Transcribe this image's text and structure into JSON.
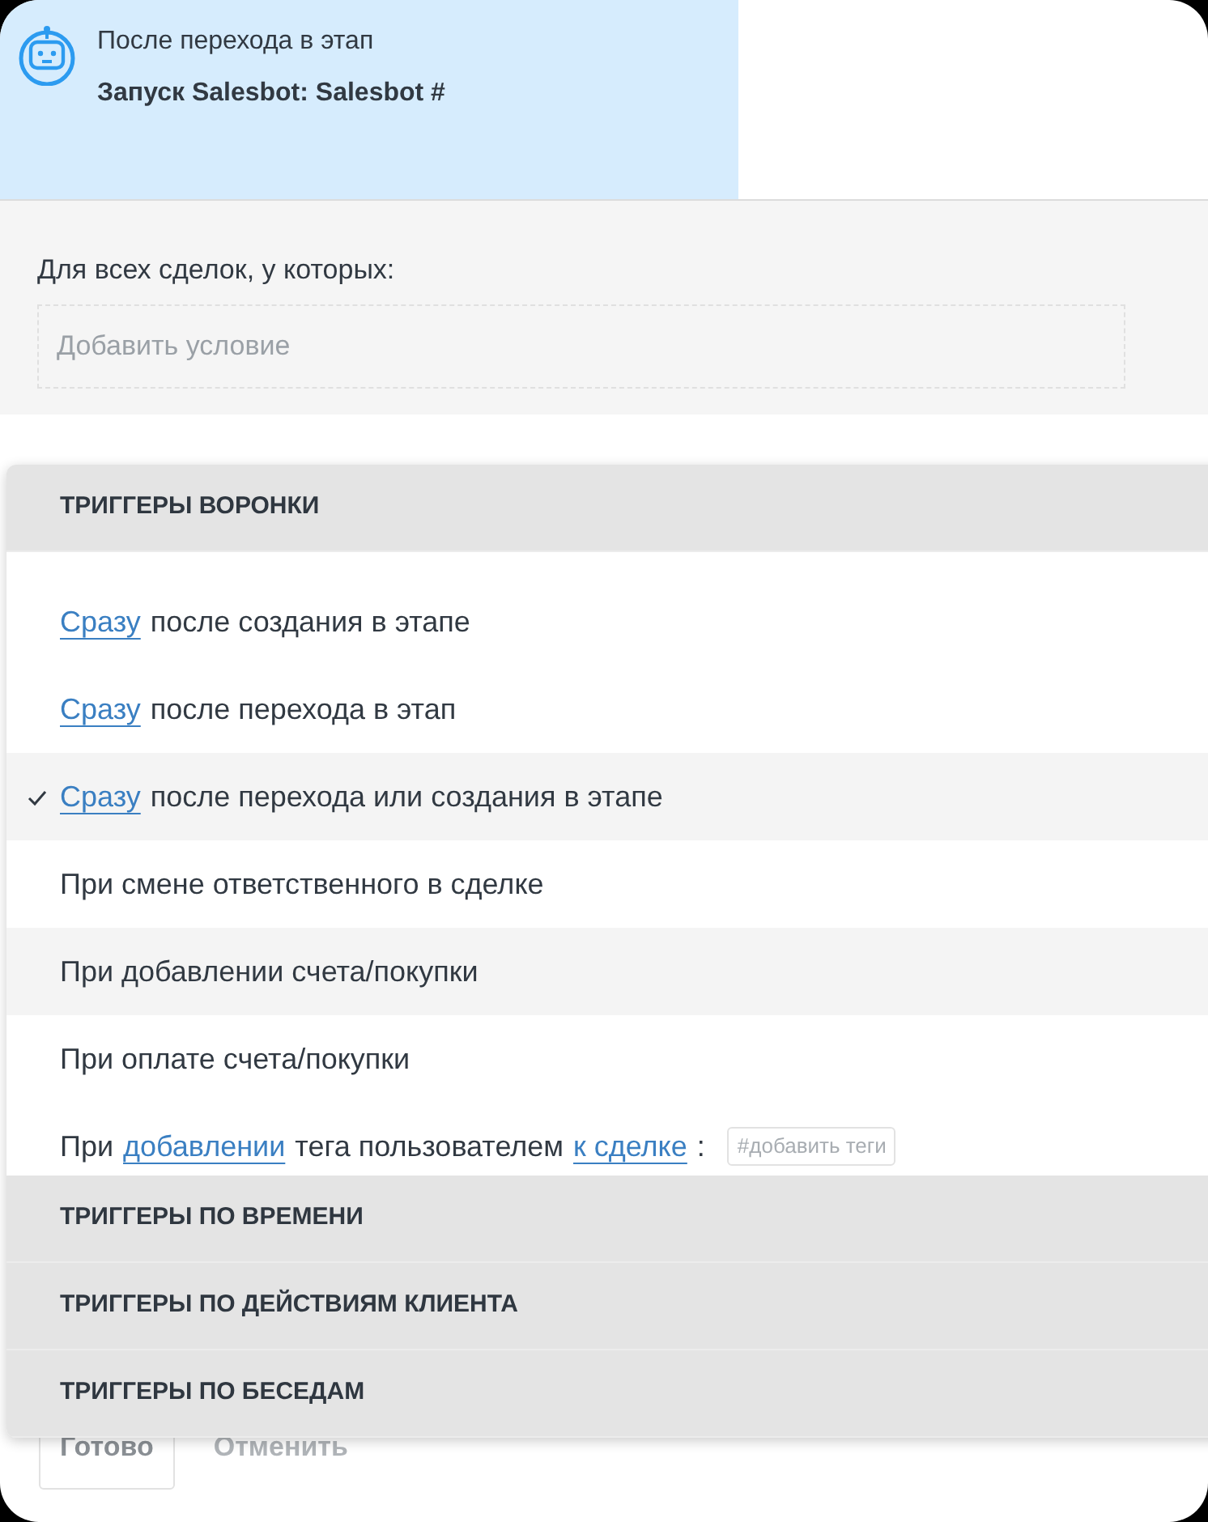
{
  "stage_card": {
    "subtitle": "После перехода в этап",
    "title": "Запуск Salesbot: Salesbot #"
  },
  "conditions": {
    "label": "Для всех сделок, у которых:",
    "placeholder": "Добавить условие"
  },
  "buttons": [
    {
      "label": "Готово",
      "kind": "outlined"
    },
    {
      "label": "Отменить",
      "kind": "plain"
    }
  ],
  "trigger_groups": [
    {
      "title": "ТРИГГЕРЫ ВОРОНКИ",
      "items": [
        {
          "selected": false,
          "highlighted": false,
          "parts": [
            {
              "text": "Сразу",
              "kind": "link"
            },
            {
              "text": "после создания в этапе",
              "kind": "text"
            }
          ]
        },
        {
          "selected": false,
          "highlighted": false,
          "parts": [
            {
              "text": "Сразу",
              "kind": "link"
            },
            {
              "text": "после перехода в этап",
              "kind": "text"
            }
          ]
        },
        {
          "selected": true,
          "highlighted": true,
          "parts": [
            {
              "text": "Сразу",
              "kind": "link"
            },
            {
              "text": "после перехода или создания в этапе",
              "kind": "text"
            }
          ]
        },
        {
          "selected": false,
          "highlighted": false,
          "parts": [
            {
              "text": "При смене ответственного в сделке",
              "kind": "text"
            }
          ]
        },
        {
          "selected": false,
          "highlighted": true,
          "parts": [
            {
              "text": "При добавлении счета/покупки",
              "kind": "text"
            }
          ]
        },
        {
          "selected": false,
          "highlighted": false,
          "parts": [
            {
              "text": "При оплате счета/покупки",
              "kind": "text"
            }
          ]
        },
        {
          "selected": false,
          "highlighted": false,
          "parts": [
            {
              "text": "При",
              "kind": "text"
            },
            {
              "text": "добавлении",
              "kind": "link"
            },
            {
              "text": "тега пользователем",
              "kind": "text"
            },
            {
              "text": "к сделке",
              "kind": "link"
            },
            {
              "text": ":",
              "kind": "text"
            },
            {
              "text": "#добавить теги",
              "kind": "tag-field"
            }
          ]
        }
      ]
    },
    {
      "title": "ТРИГГЕРЫ ПО ВРЕМЕНИ"
    },
    {
      "title": "ТРИГГЕРЫ ПО ДЕЙСТВИЯМ КЛИЕНТА"
    },
    {
      "title": "ТРИГГЕРЫ ПО БЕСЕДАМ"
    }
  ]
}
